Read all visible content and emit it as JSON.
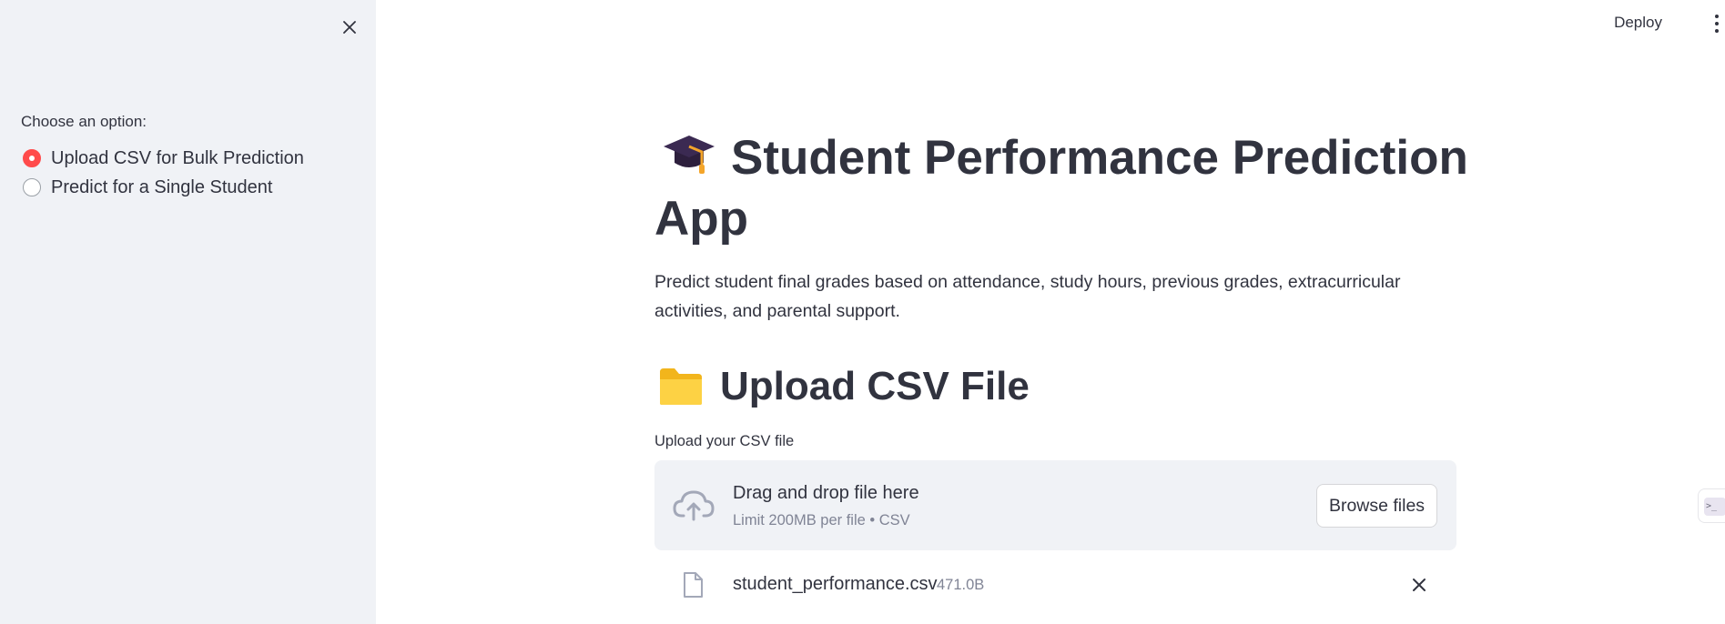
{
  "sidebar": {
    "label": "Choose an option:",
    "options": [
      {
        "label": "Upload CSV for Bulk Prediction",
        "selected": true
      },
      {
        "label": "Predict for a Single Student",
        "selected": false
      }
    ],
    "close_icon": "close-icon"
  },
  "topbar": {
    "deploy_label": "Deploy",
    "menu_icon": "vertical-ellipsis-icon"
  },
  "main": {
    "title_icon": "graduation-cap-icon",
    "title": "Student Performance Prediction App",
    "description": "Predict student final grades based on attendance, study hours, previous grades, extracurricular activities, and parental support.",
    "subheader_icon": "folder-icon",
    "subheader": "Upload CSV File",
    "uploader": {
      "label": "Upload your CSV file",
      "drop_title": "Drag and drop file here",
      "drop_sub": "Limit 200MB per file • CSV",
      "browse_label": "Browse files",
      "icon": "cloud-upload-icon"
    },
    "uploaded_file": {
      "name": "student_performance.csv",
      "size": "471.0B",
      "icon": "file-icon",
      "remove_icon": "close-icon"
    }
  },
  "colors": {
    "accent": "#ff4b4b",
    "sidebar_bg": "#f0f2f6",
    "text": "#31333f",
    "muted": "#808495"
  }
}
